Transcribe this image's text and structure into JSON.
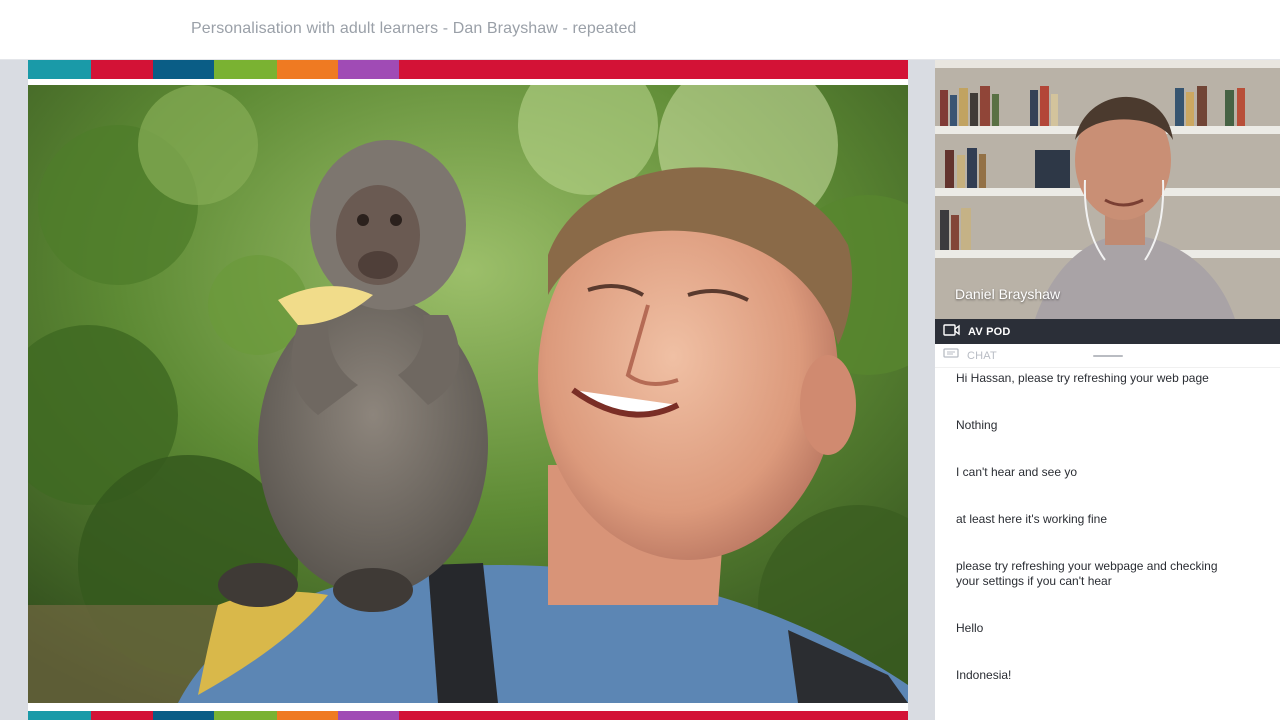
{
  "header": {
    "title": "Personalisation with adult learners - Dan Brayshaw - repeated"
  },
  "slide": {
    "stripe_colors": [
      "#1a9aa8",
      "#d31236",
      "#0a5d86",
      "#7ab232",
      "#ef7a22",
      "#a04bb5",
      "#d31236"
    ],
    "photo_description_icon": "photo-image"
  },
  "video": {
    "participant_name": "Daniel Brayshaw"
  },
  "pod": {
    "label": "AV POD",
    "icon": "camera-icon"
  },
  "chat": {
    "label": "CHAT",
    "icon": "chat-icon",
    "messages": [
      "Hi Hassan, please try refreshing your web page",
      "Nothing",
      "I can't hear and see yo",
      "at least here it's working fine",
      "please try refreshing your webpage and checking your settings if you can't hear",
      "Hello",
      "Indonesia!"
    ]
  }
}
